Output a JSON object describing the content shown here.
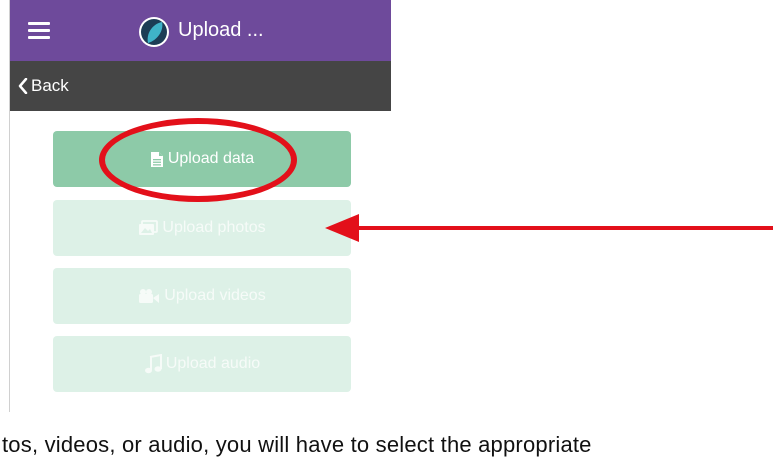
{
  "app_bar": {
    "title": "Upload ...",
    "menu_icon": "hamburger-icon",
    "logo_icon": "app-logo-icon",
    "background": "#6e4a9b"
  },
  "nav_bar": {
    "back_label": "Back",
    "background": "#454545"
  },
  "buttons": [
    {
      "label": "Upload data",
      "icon": "document-icon",
      "state": "active"
    },
    {
      "label": "Upload photos",
      "icon": "photos-icon",
      "state": "disabled"
    },
    {
      "label": "Upload videos",
      "icon": "video-camera-icon",
      "state": "disabled"
    },
    {
      "label": "Upload audio",
      "icon": "music-note-icon",
      "state": "disabled"
    }
  ],
  "annotations": {
    "ellipse_color": "#e3101a",
    "arrow_color": "#e3101a"
  },
  "caption": "tos, videos, or audio, you will have to select the appropriate"
}
